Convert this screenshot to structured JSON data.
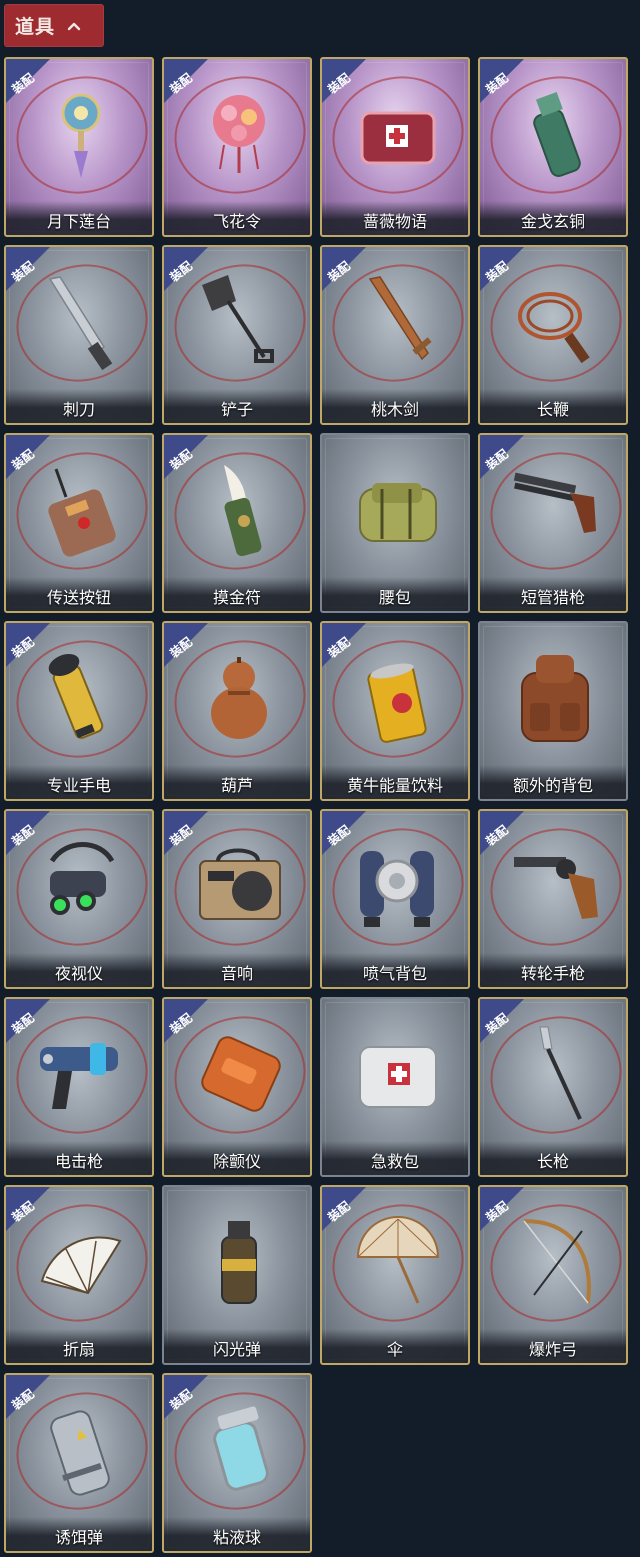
{
  "header": {
    "title": "道具"
  },
  "equip_badge": "装配",
  "items": [
    {
      "name": "月下莲台",
      "equipped": true,
      "theme": "purple",
      "icon": "lotus-lantern-icon"
    },
    {
      "name": "飞花令",
      "equipped": true,
      "theme": "purple",
      "icon": "flower-ball-icon"
    },
    {
      "name": "蔷薇物语",
      "equipped": true,
      "theme": "purple",
      "icon": "rose-medkit-icon"
    },
    {
      "name": "金戈玄铜",
      "equipped": true,
      "theme": "purple",
      "icon": "bronze-grenade-icon"
    },
    {
      "name": "刺刀",
      "equipped": true,
      "theme": "grey",
      "icon": "bayonet-icon"
    },
    {
      "name": "铲子",
      "equipped": true,
      "theme": "grey",
      "icon": "shovel-icon"
    },
    {
      "name": "桃木剑",
      "equipped": true,
      "theme": "grey",
      "icon": "wooden-sword-icon"
    },
    {
      "name": "长鞭",
      "equipped": true,
      "theme": "grey",
      "icon": "whip-icon"
    },
    {
      "name": "传送按钮",
      "equipped": true,
      "theme": "grey",
      "icon": "teleport-remote-icon"
    },
    {
      "name": "摸金符",
      "equipped": true,
      "theme": "grey",
      "icon": "tooth-amulet-icon"
    },
    {
      "name": "腰包",
      "equipped": false,
      "theme": "plain",
      "icon": "waist-bag-icon"
    },
    {
      "name": "短管猎枪",
      "equipped": true,
      "theme": "grey",
      "icon": "shotgun-icon"
    },
    {
      "name": "专业手电",
      "equipped": true,
      "theme": "grey",
      "icon": "flashlight-icon"
    },
    {
      "name": "葫芦",
      "equipped": true,
      "theme": "grey",
      "icon": "gourd-icon"
    },
    {
      "name": "黄牛能量饮料",
      "equipped": true,
      "theme": "grey",
      "icon": "energy-drink-icon"
    },
    {
      "name": "额外的背包",
      "equipped": false,
      "theme": "plain",
      "icon": "backpack-icon"
    },
    {
      "name": "夜视仪",
      "equipped": true,
      "theme": "grey",
      "icon": "night-vision-icon"
    },
    {
      "name": "音响",
      "equipped": true,
      "theme": "grey",
      "icon": "radio-speaker-icon"
    },
    {
      "name": "喷气背包",
      "equipped": true,
      "theme": "grey",
      "icon": "jetpack-icon"
    },
    {
      "name": "转轮手枪",
      "equipped": true,
      "theme": "grey",
      "icon": "revolver-icon"
    },
    {
      "name": "电击枪",
      "equipped": true,
      "theme": "grey",
      "icon": "stun-gun-icon"
    },
    {
      "name": "除颤仪",
      "equipped": true,
      "theme": "grey",
      "icon": "defibrillator-icon"
    },
    {
      "name": "急救包",
      "equipped": false,
      "theme": "plain",
      "icon": "first-aid-kit-icon"
    },
    {
      "name": "长枪",
      "equipped": true,
      "theme": "grey",
      "icon": "spear-icon"
    },
    {
      "name": "折扇",
      "equipped": true,
      "theme": "grey",
      "icon": "folding-fan-icon"
    },
    {
      "name": "闪光弹",
      "equipped": false,
      "theme": "plain",
      "icon": "flashbang-icon"
    },
    {
      "name": "伞",
      "equipped": true,
      "theme": "grey",
      "icon": "umbrella-icon"
    },
    {
      "name": "爆炸弓",
      "equipped": true,
      "theme": "grey",
      "icon": "explosive-bow-icon"
    },
    {
      "name": "诱饵弹",
      "equipped": true,
      "theme": "grey",
      "icon": "decoy-canister-icon"
    },
    {
      "name": "粘液球",
      "equipped": true,
      "theme": "grey",
      "icon": "slime-jar-icon"
    }
  ],
  "colors": {
    "background": "#131c29",
    "header_tab": "#9e2b2f",
    "frame_gold": "#bfa765",
    "badge_blue": "#3f4a8a"
  }
}
